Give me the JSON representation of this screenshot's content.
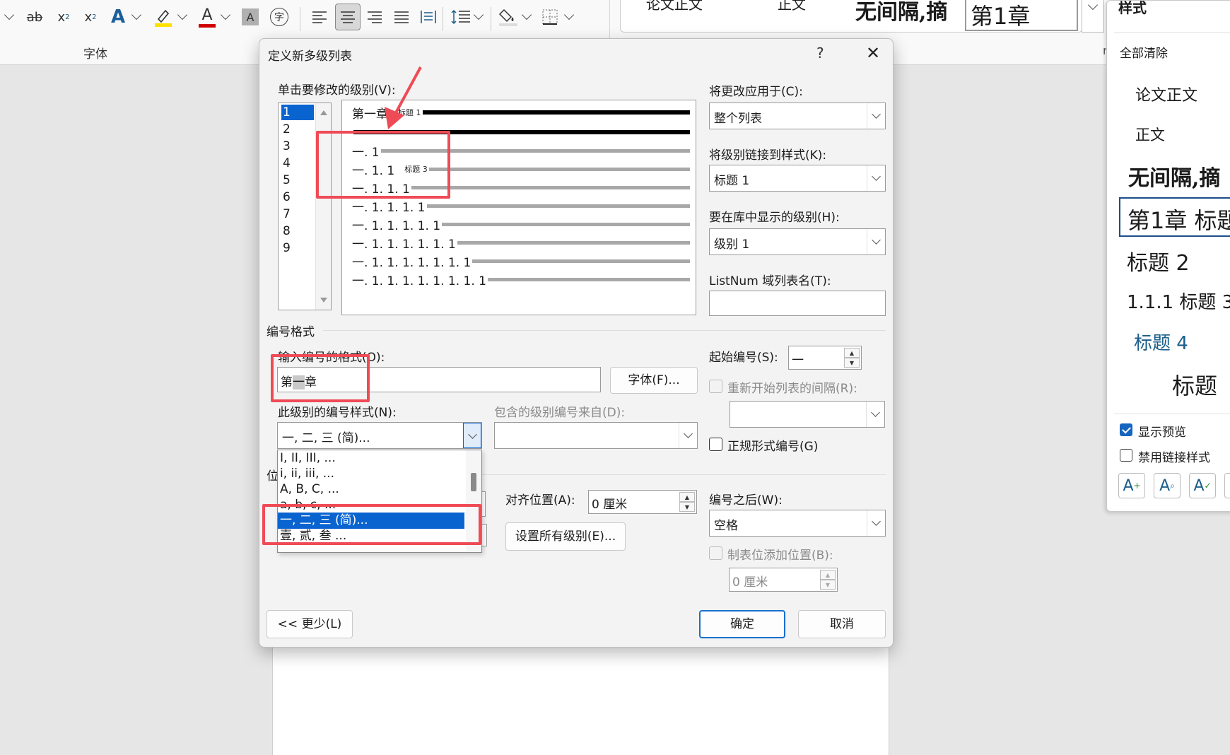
{
  "ribbon": {
    "group_font_label": "字体",
    "icons": [
      "strikethrough-icon",
      "subscript-icon",
      "superscript-icon",
      "text-effects-icon",
      "highlight-icon",
      "font-color-icon",
      "char-shading-icon",
      "enclose-char-icon",
      "align-left-icon",
      "align-center-icon",
      "align-right-icon",
      "justify-icon",
      "distributed-icon",
      "line-spacing-icon",
      "shading-icon",
      "borders-icon"
    ],
    "gallery": [
      "论文正文",
      "正文",
      "无间隔,摘",
      "第1章"
    ],
    "pane_label_partial": "r",
    "accent_font_color": "#d00000",
    "highlight_color": "#ffe000"
  },
  "styles_pane": {
    "title": "样式",
    "clear_all": "全部清除",
    "items": [
      "论文正文",
      "正文",
      "无间隔,摘",
      "第1章  标题",
      "标题 2",
      "1.1.1  标题 3",
      "标题 4",
      "标题"
    ],
    "show_preview_label": "显示预览",
    "show_preview_checked": true,
    "disable_linked_label": "禁用链接样式",
    "disable_linked_checked": false,
    "footer_icons": [
      "new-style-icon",
      "style-inspector-icon",
      "manage-styles-icon"
    ]
  },
  "dialog": {
    "title": "定义新多级列表",
    "help": "?",
    "close": "✕",
    "level_label": "单击要修改的级别(V):",
    "levels": [
      "1",
      "2",
      "3",
      "4",
      "5",
      "6",
      "7",
      "8",
      "9"
    ],
    "selected_level": "1",
    "preview": [
      {
        "num": "第一章",
        "tag": "标题 1",
        "style": "dark"
      },
      {
        "num": "",
        "tag": "",
        "style": "dark"
      },
      {
        "num": "一. 1",
        "tag": "",
        "style": "gray"
      },
      {
        "num": "一. 1. 1",
        "tag": "标题 3",
        "style": "gray"
      },
      {
        "num": "一. 1. 1. 1",
        "tag": "",
        "style": "gray"
      },
      {
        "num": "一. 1. 1. 1. 1",
        "tag": "",
        "style": "gray"
      },
      {
        "num": "一. 1. 1. 1. 1. 1",
        "tag": "",
        "style": "gray"
      },
      {
        "num": "一. 1. 1. 1. 1. 1. 1",
        "tag": "",
        "style": "gray"
      },
      {
        "num": "一. 1. 1. 1. 1. 1. 1. 1",
        "tag": "",
        "style": "gray"
      },
      {
        "num": "一. 1. 1. 1. 1. 1. 1. 1. 1",
        "tag": "",
        "style": "gray"
      }
    ],
    "apply_to_label": "将更改应用于(C):",
    "apply_to_value": "整个列表",
    "link_style_label": "将级别链接到样式(K):",
    "link_style_value": "标题 1",
    "gallery_level_label": "要在库中显示的级别(H):",
    "gallery_level_value": "级别 1",
    "listnum_label": "ListNum 域列表名(T):",
    "listnum_value": "",
    "number_format_section": "编号格式",
    "enter_format_label": "输入编号的格式(O):",
    "format_value_pre": "第",
    "format_value_field": "一",
    "format_value_post": "章",
    "font_button": "字体(F)...",
    "number_style_label": "此级别的编号样式(N):",
    "number_style_value": "一, 二, 三 (简)...",
    "include_from_label": "包含的级别编号来自(D):",
    "start_at_label": "起始编号(S):",
    "start_at_value": "一",
    "restart_label": "重新开始列表的间隔(R):",
    "legal_label": "正规形式编号(G)",
    "style_options": [
      "I, II, III, ...",
      "i, ii, iii, ...",
      "A, B, C, ...",
      "a, b, c, ...",
      "一, 二, 三 (简)...",
      "壹, 贰, 叁 ..."
    ],
    "selected_option": "一, 二, 三 (简)...",
    "position_section": "位",
    "align_at_label": "对齐位置(A):",
    "align_at_value": "0 厘米",
    "set_all_button": "设置所有级别(E)...",
    "follow_number_label": "编号之后(W):",
    "follow_number_value": "空格",
    "tab_stop_label": "制表位添加位置(B):",
    "tab_stop_value": "0 厘米",
    "less_button": "<< 更少(L)",
    "ok_button": "确定",
    "cancel_button": "取消"
  },
  "annotation_color": "#ef4b56"
}
